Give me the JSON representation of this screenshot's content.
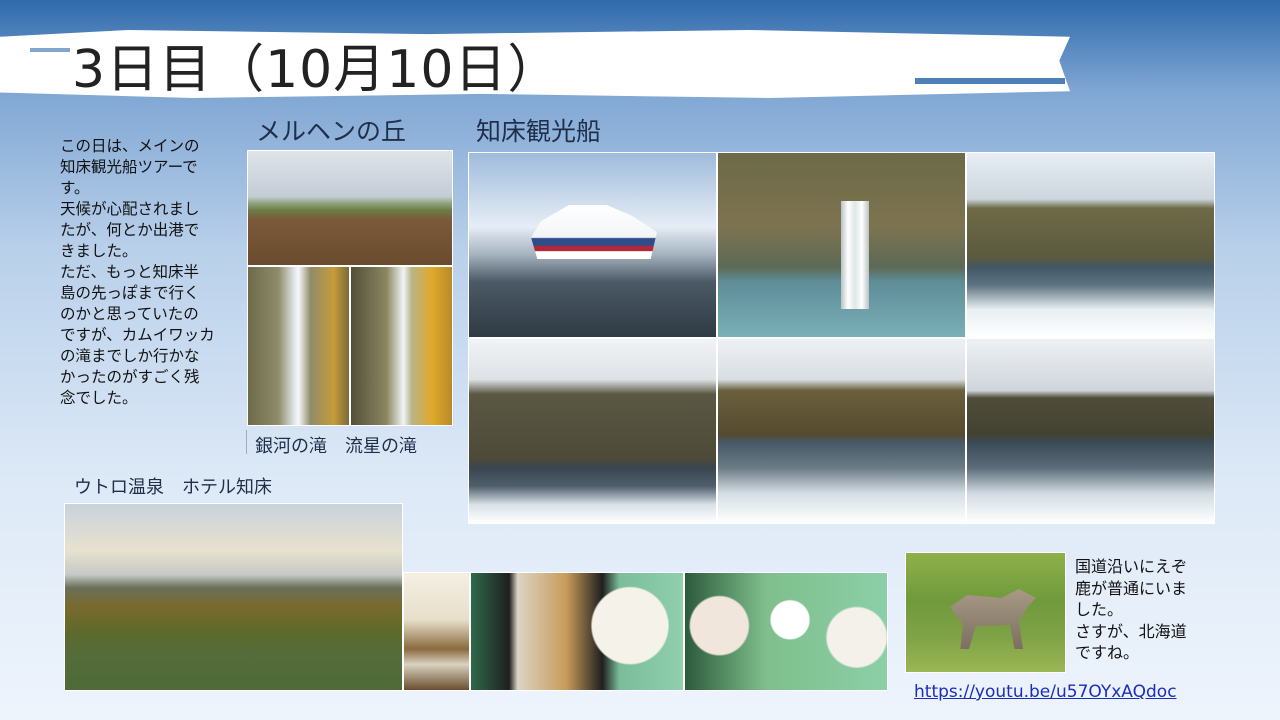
{
  "title": "3日目（10月10日）",
  "intro_text": "この日は、メインの\n知床観光船ツアーで\nす。\n天候が心配されまし\nたが、何とか出港で\nきました。\nただ、もっと知床半\n島の先っぽまで行く\nのかと思っていたの\nですが、カムイワッカ\nの滝までしか行かな\nかったのがすごく残\n念でした。",
  "sections": {
    "hill_caption": "メルヘンの丘",
    "cruise_caption": "知床観光船",
    "waterfalls_caption": "銀河の滝　流星の滝",
    "hotel_caption": "ウトロ温泉　ホテル知床"
  },
  "deer_text": "国道沿いにえぞ\n鹿が普通にいま\nした。\nさすが、北海道\nですね。",
  "link": {
    "label": "https://youtu.be/u57OYxAQdoc"
  },
  "colors": {
    "header_blue": "#2f6aab",
    "link_blue": "#1a2dbd"
  }
}
